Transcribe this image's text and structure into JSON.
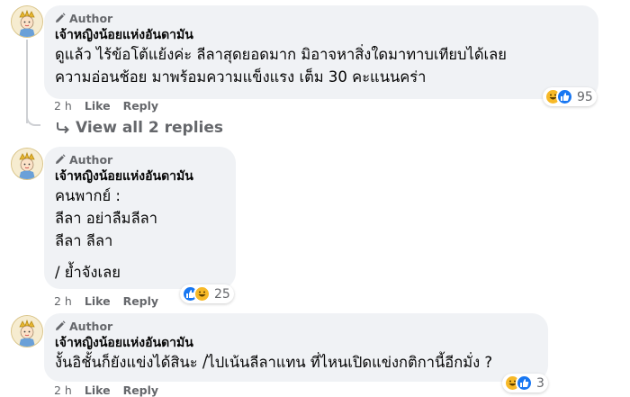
{
  "comments": [
    {
      "author_tag": "Author",
      "name": "เจ้าหญิงน้อยแห่งอันดามัน",
      "lines": [
        "ดูแล้ว ไร้ข้อโต้แย้งค่ะ ลีลาสุดยอดมาก มิอาจหาสิ่งใดมาทาบเทียบได้เลย",
        "ความอ่อนช้อย มาพร้อมความแข็งแรง เต็ม 30 คะแนนคร่า"
      ],
      "time": "2 h",
      "like_label": "Like",
      "reply_label": "Reply",
      "reaction_count": "95",
      "reaction_icons": [
        "haha-icon",
        "like-icon"
      ]
    },
    {
      "author_tag": "Author",
      "name": "เจ้าหญิงน้อยแห่งอันดามัน",
      "lines": [
        "คนพากย์ :",
        "ลีลา อย่าลืมลีลา",
        "ลีลา ลีลา",
        "",
        "/ ย้ำจังเลย"
      ],
      "time": "2 h",
      "like_label": "Like",
      "reply_label": "Reply",
      "reaction_count": "25",
      "reaction_icons": [
        "like-icon",
        "haha-icon"
      ]
    },
    {
      "author_tag": "Author",
      "name": "เจ้าหญิงน้อยแห่งอันดามัน",
      "lines": [
        "งั้นอิชั้นก็ยังแข่งได้สินะ /ไปเน้นลีลาแทน ที่ไหนเปิดแข่งกติกานี้อีกมั่ง ?"
      ],
      "time": "2 h",
      "like_label": "Like",
      "reply_label": "Reply",
      "reaction_count": "3",
      "reaction_icons": [
        "haha-icon",
        "like-icon"
      ]
    }
  ],
  "view_replies_label": "View all 2 replies",
  "colors": {
    "bubble": "#f0f2f5",
    "secondary_text": "#65676b",
    "like_blue": "#1877f2",
    "haha_yellow": "#f7b928"
  }
}
